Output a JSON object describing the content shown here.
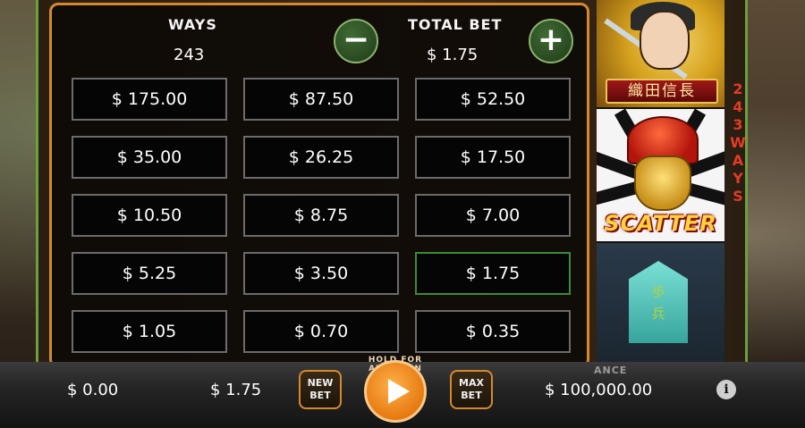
{
  "bet_panel": {
    "ways_label": "WAYS",
    "ways_value": "243",
    "total_bet_label": "TOTAL BET",
    "total_bet_value": "$ 1.75",
    "decrease_symbol": "−",
    "increase_symbol": "+",
    "selected_value": "$ 1.75",
    "options": [
      "$ 175.00",
      "$ 87.50",
      "$ 52.50",
      "$ 35.00",
      "$ 26.25",
      "$ 17.50",
      "$ 10.50",
      "$ 8.75",
      "$ 7.00",
      "$ 5.25",
      "$ 3.50",
      "$ 1.75",
      "$ 1.05",
      "$ 0.70",
      "$ 0.35"
    ]
  },
  "reels": {
    "warrior_plate_text": "織田信長",
    "scatter_text": "SCATTER",
    "pawn_chars": [
      "歩",
      "兵"
    ],
    "ways_banner": [
      "2",
      "4",
      "3",
      "W",
      "A",
      "Y",
      "S"
    ]
  },
  "bottom_bar": {
    "win_value": "$ 0.00",
    "bet_value": "$ 1.75",
    "new_bet_label": [
      "NEW",
      "BET"
    ],
    "max_bet_label": [
      "MAX",
      "BET"
    ],
    "spin_arc_text": "HOLD FOR AUTOSPIN",
    "balance_label": "ANCE",
    "balance_value": "$ 100,000.00",
    "info_symbol": "i"
  },
  "colors": {
    "panel_border": "#d5892e",
    "selected_border": "#3d8a3a",
    "cell_border": "#6b6b6b",
    "spin_orange": "#e67a11"
  },
  "icons": [
    "minus-icon",
    "plus-icon",
    "play-icon",
    "info-icon"
  ]
}
